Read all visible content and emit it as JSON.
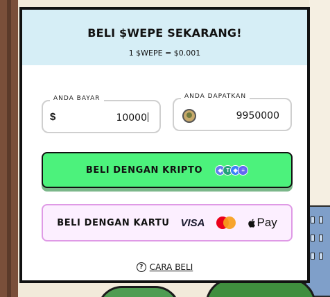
{
  "header": {
    "title": "BELI $WEPE SEKARANG!",
    "rate": "1 $WEPE = $0.001"
  },
  "pay_field": {
    "label": "ANDA BAYAR",
    "prefix": "$",
    "value": "10000"
  },
  "receive_field": {
    "label": "ANDA DAPATKAN",
    "value": "9950000",
    "icon": "wepe-token-icon"
  },
  "crypto_button": {
    "label": "BELI DENGAN KRIPTO",
    "icons": [
      {
        "name": "ethereum-icon",
        "color": "#627eea",
        "glyph": "◆"
      },
      {
        "name": "tether-icon",
        "color": "#26a17b",
        "glyph": "T"
      },
      {
        "name": "bnb-icon",
        "color": "#3b82f6",
        "glyph": "◈"
      },
      {
        "name": "solana-icon",
        "color": "#6366f1",
        "glyph": "≡"
      }
    ],
    "color": "#4cf27c"
  },
  "card_button": {
    "label": "BELI DENGAN KARTU",
    "visa": "VISA",
    "apple_pay": "Pay",
    "color": "#fcefff"
  },
  "help": {
    "label": "CARA BELI",
    "icon": "?"
  }
}
